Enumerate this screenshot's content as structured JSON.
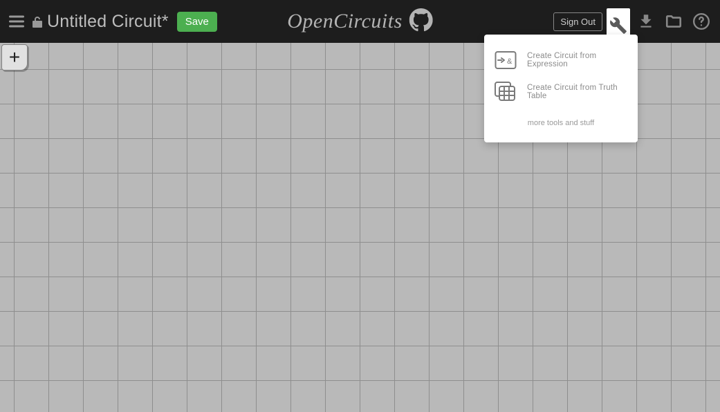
{
  "header": {
    "title": "Untitled Circuit*",
    "save_label": "Save",
    "brand": "OpenCircuits",
    "signout_label": "Sign Out"
  },
  "add_button_label": "+",
  "tools_menu": {
    "items": [
      {
        "label": "Create Circuit from Expression"
      },
      {
        "label": "Create Circuit from Truth Table"
      }
    ],
    "footer": "more tools and stuff"
  },
  "icons": {
    "menu": "hamburger-icon",
    "lock": "unlock-icon",
    "github": "github-icon",
    "wrench": "wrench-icon",
    "download": "download-icon",
    "folder": "folder-icon",
    "help": "help-icon",
    "expression": "expression-icon",
    "truth_table": "truth-table-icon"
  },
  "colors": {
    "header_bg": "#1d1d1d",
    "canvas_bg": "#c5c5c5",
    "grid_line": "#979797",
    "save_bg": "#4CAF50",
    "icon_muted": "#888888",
    "dropdown_text": "#8a8a8a"
  }
}
